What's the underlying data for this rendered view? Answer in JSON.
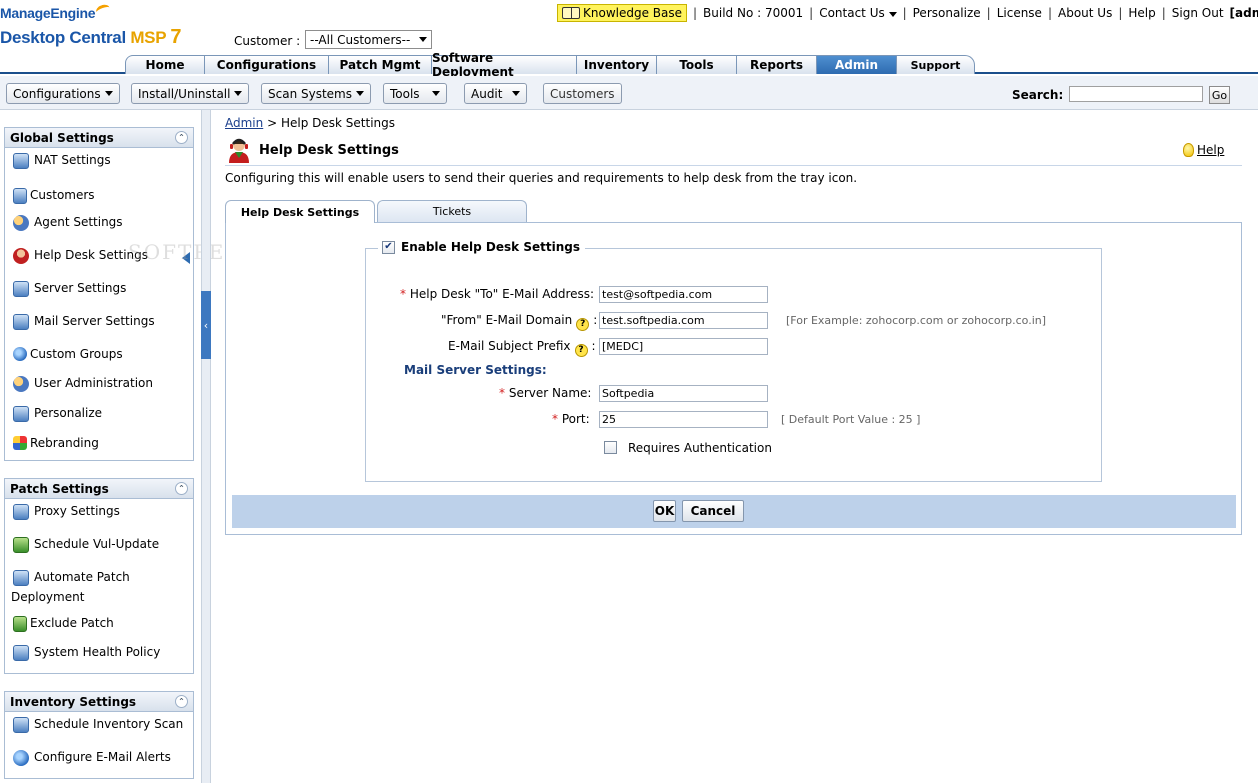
{
  "header": {
    "logo_top": "ManageEngine",
    "logo_product": "Desktop Central",
    "logo_edition": "MSP",
    "logo_version": "7",
    "customer_label": "Customer :",
    "customer_value": "--All Customers--",
    "toplinks": {
      "knowledge_base": "Knowledge Base",
      "build": "Build No : 70001",
      "contact_us": "Contact Us",
      "personalize": "Personalize",
      "license": "License",
      "about_us": "About Us",
      "help": "Help",
      "sign_out": "Sign Out",
      "user": "[admin]"
    }
  },
  "tabs": [
    "Home",
    "Configurations",
    "Patch Mgmt",
    "Software Deployment",
    "Inventory",
    "Tools",
    "Reports",
    "Admin",
    "Support"
  ],
  "active_tab": "Admin",
  "subtoolbar": {
    "items": [
      "Configurations",
      "Install/Uninstall",
      "Scan Systems",
      "Tools",
      "Audit"
    ],
    "customers": "Customers",
    "search_label": "Search:",
    "search_value": "",
    "go": "Go"
  },
  "sidebar": {
    "global": {
      "title": "Global Settings",
      "items": [
        "NAT Settings",
        "Customers",
        "Agent Settings",
        "Help Desk Settings",
        "Server Settings",
        "Mail Server Settings",
        "Custom Groups",
        "User Administration",
        "Personalize",
        "Rebranding"
      ]
    },
    "patch": {
      "title": "Patch Settings",
      "items": [
        "Proxy Settings",
        "Schedule Vul-Update",
        "Automate Patch",
        "Deployment",
        "Exclude Patch",
        "System Health Policy"
      ]
    },
    "inventory": {
      "title": "Inventory Settings",
      "items": [
        "Schedule Inventory Scan",
        "Configure E-Mail Alerts"
      ]
    }
  },
  "content": {
    "breadcrumb_root": "Admin",
    "breadcrumb_sep": ">",
    "breadcrumb_current": "Help Desk Settings",
    "title": "Help Desk Settings",
    "help": "Help",
    "description": "Configuring this will enable users to send their queries and requirements to help desk from the tray icon.",
    "tabs": [
      "Help Desk Settings",
      "Tickets"
    ],
    "enable_label": "Enable Help Desk Settings",
    "enable_checked": true,
    "form": {
      "to_label": "Help Desk \"To\" E-Mail Address:",
      "to_value": "test@softpedia.com",
      "from_label": "\"From\" E-Mail Domain",
      "from_value": "test.softpedia.com",
      "from_hint": "[For Example: zohocorp.com or zohocorp.co.in]",
      "subject_label": "E-Mail Subject Prefix",
      "subject_value": "[MEDC]",
      "mail_heading": "Mail Server Settings:",
      "server_label": "Server Name:",
      "server_value": "Softpedia",
      "port_label": "Port:",
      "port_value": "25",
      "port_hint": "[ Default Port Value : 25 ]",
      "auth_label": "Requires Authentication",
      "auth_checked": false
    },
    "ok": "OK",
    "cancel": "Cancel"
  },
  "watermark": "SOFTPEDIA"
}
